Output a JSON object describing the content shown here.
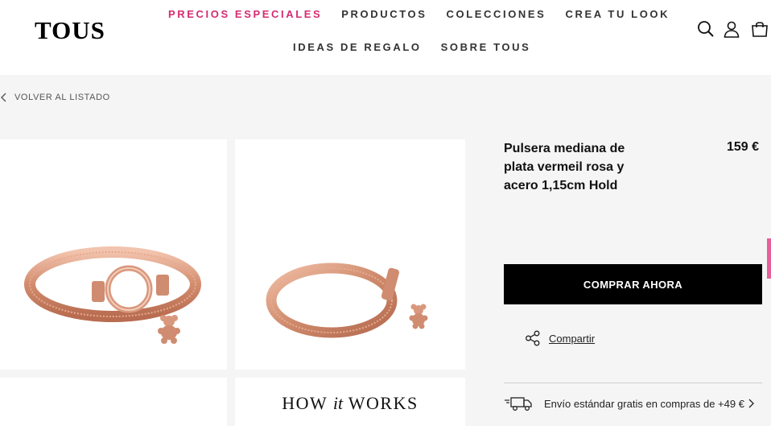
{
  "header": {
    "logo": "TOUS",
    "nav_row1": [
      "PRECIOS ESPECIALES",
      "PRODUCTOS",
      "COLECCIONES",
      "CREA TU LOOK"
    ],
    "nav_row2": [
      "IDEAS DE REGALO",
      "SOBRE TOUS"
    ],
    "special_color": "#d52c70",
    "icons": [
      "search-icon",
      "user-icon",
      "shopping-bag-icon"
    ]
  },
  "breadcrumb": {
    "back_label": "VOLVER AL LISTADO"
  },
  "gallery": {
    "promo_title_pre": "HOW ",
    "promo_title_it": "it",
    "promo_title_post": " WORKS"
  },
  "product": {
    "name": "Pulsera mediana de plata vermeil rosa y acero 1,15cm Hold",
    "price": "159 €",
    "buy_label": "COMPRAR AHORA",
    "share_label": "Compartir",
    "shipping_text": "Envío estándar gratis en compras de +49 €"
  },
  "colors": {
    "accent": "#d52c70",
    "button_bg": "#000000",
    "rose_gold": "#d9987d"
  }
}
